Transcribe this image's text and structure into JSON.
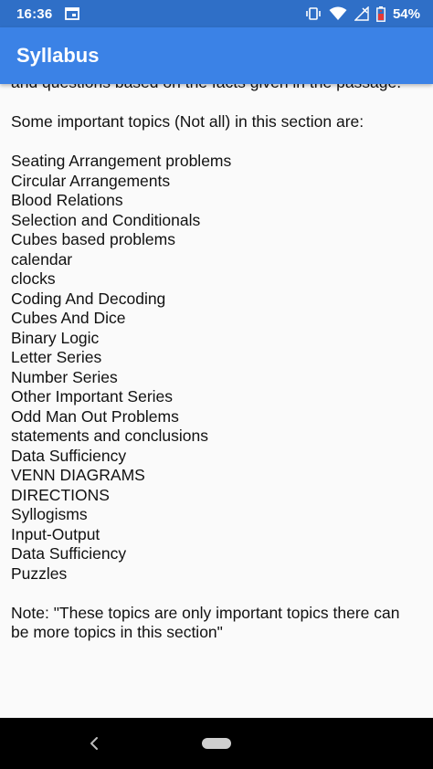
{
  "status_bar": {
    "time": "16:36",
    "battery": "54%",
    "icons": [
      "calendar-icon",
      "vibrate-icon",
      "wifi-icon",
      "no-signal-icon",
      "battery-icon"
    ]
  },
  "app_bar": {
    "title": "Syllabus"
  },
  "content": {
    "cut_line": "and questions based on the facts given in the passage.",
    "intro": "Some important topics (Not all) in this section are:",
    "topics": [
      "Seating Arrangement problems",
      "Circular Arrangements",
      "Blood Relations",
      "Selection and Conditionals",
      "Cubes based problems",
      "calendar",
      "clocks",
      "Coding And Decoding",
      "Cubes And Dice",
      "Binary Logic",
      "Letter Series",
      "Number Series",
      "Other Important Series",
      "Odd Man Out Problems",
      "statements and conclusions",
      "Data Sufficiency",
      "VENN DIAGRAMS",
      "DIRECTIONS",
      "Syllogisms",
      "Input-Output",
      "Data Sufficiency",
      "Puzzles"
    ],
    "note_line1": "Note: \"These topics are only important topics there can",
    "note_line2": "be more topics in this section\""
  },
  "nav_bar": {
    "icons": [
      "back-icon",
      "home-pill-icon"
    ]
  },
  "colors": {
    "status_bar": "#2f6fc7",
    "app_bar": "#3b82e6",
    "background": "#fafafa",
    "text": "#111111",
    "nav_bar": "#000000",
    "battery_alert": "#e53935"
  }
}
